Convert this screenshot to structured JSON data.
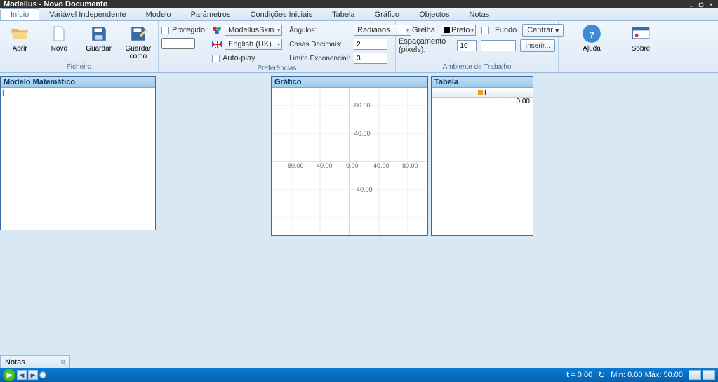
{
  "title": "Modellus - Novo Documento",
  "menu": {
    "tabs": [
      "Início",
      "Variável Independente",
      "Modelo",
      "Parâmetros",
      "Condições Iniciais",
      "Tabela",
      "Gráfico",
      "Objectos",
      "Notas"
    ],
    "active_index": 0
  },
  "ribbon": {
    "ficheiro": {
      "label": "Ficheiro",
      "abrir": "Abrir",
      "novo": "Novo",
      "guardar": "Guardar",
      "guardar_como": "Guardar como"
    },
    "preferencias": {
      "label": "Preferências",
      "protegido": "Protegido",
      "skin": "ModellusSkin",
      "lang": "English (UK)",
      "autoplay": "Auto-play",
      "angulos": "Ângulos:",
      "angulos_val": "Radianos",
      "casas": "Casas Decimais:",
      "casas_val": "2",
      "limite": "Limite Exponencial:",
      "limite_val": "3"
    },
    "ambiente": {
      "label": "Ambiente de Trabalho",
      "grelha": "Grelha",
      "grelha_color": "Preto",
      "fundo": "Fundo",
      "centrar": "Centrar",
      "espacamento": "Espaçamento (pixels):",
      "espacamento_val": "10",
      "inserir": "Inserir..."
    },
    "ajuda": "Ajuda",
    "sobre": "Sobre"
  },
  "panels": {
    "modelo": {
      "title": "Modelo Matemático"
    },
    "grafico": {
      "title": "Gráfico"
    },
    "tabela": {
      "title": "Tabela",
      "col_header": "t",
      "row0": "0.00"
    }
  },
  "notes_tab": "Notas",
  "chart_data": {
    "type": "line",
    "series": [],
    "x_ticks": [
      "-80.00",
      "-40.00",
      "0.00",
      "40.00",
      "80.00"
    ],
    "y_ticks_pos": [
      "80.00",
      "40.00"
    ],
    "y_ticks_neg": [
      "-40.00"
    ],
    "xlim": [
      -100,
      100
    ],
    "ylim": [
      -100,
      100
    ]
  },
  "status": {
    "t_label": "t  = 0.00",
    "min_label": "Min: 0.00",
    "max_label": "Máx: 50.00"
  }
}
